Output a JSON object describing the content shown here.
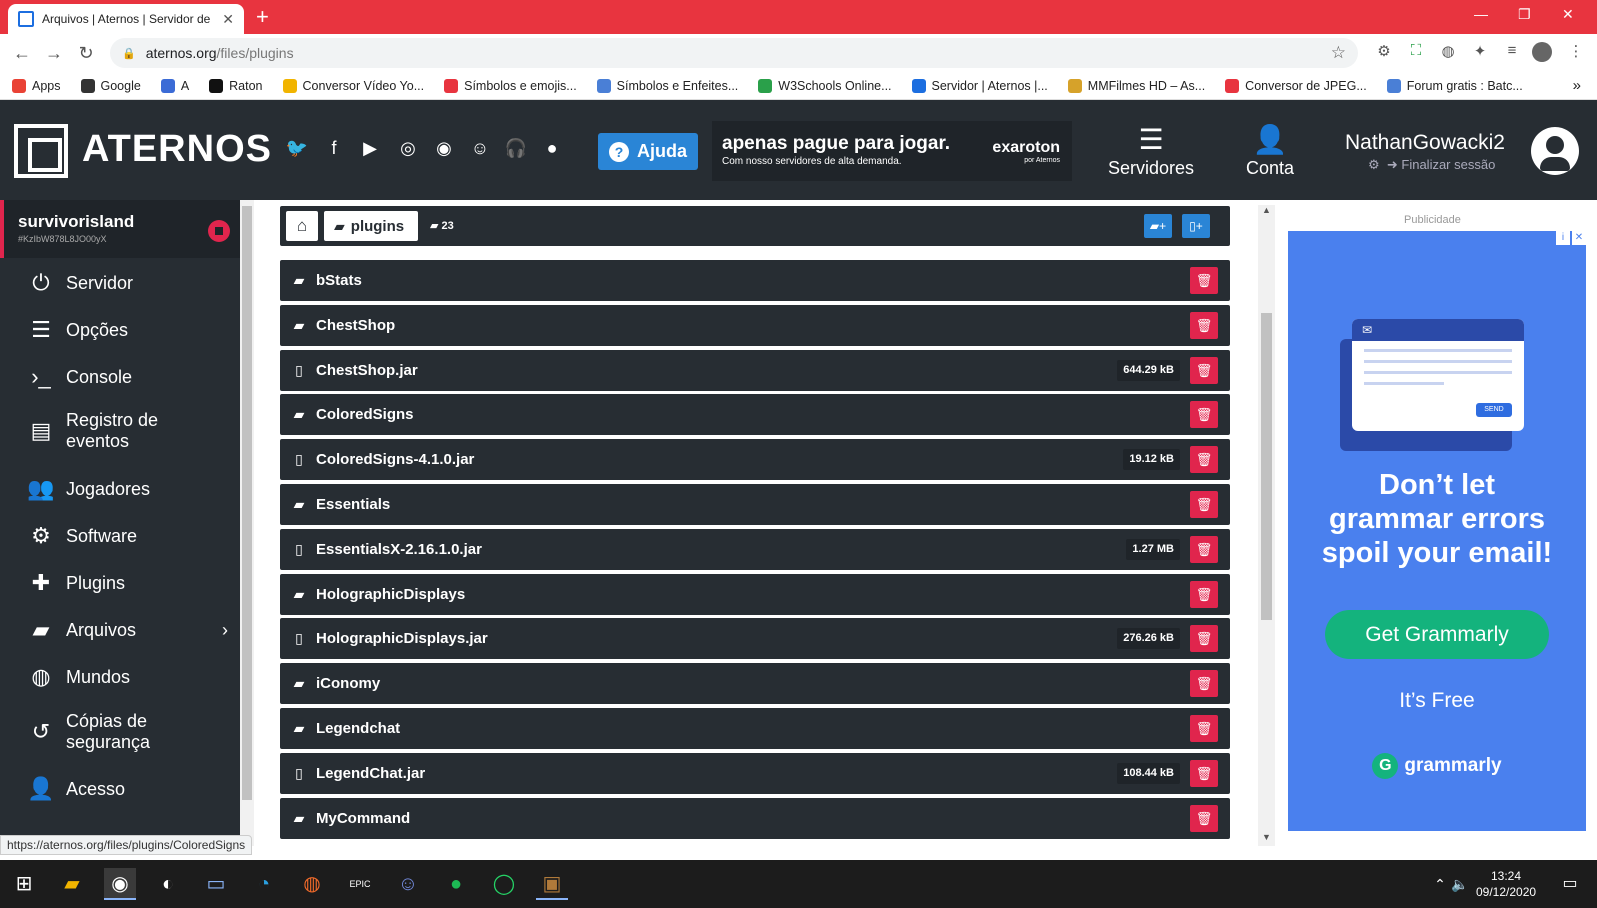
{
  "browser": {
    "tab_title": "Arquivos | Aternos | Servidor de M",
    "url_domain": "aternos.org",
    "url_path": "/files/plugins",
    "bookmarks": [
      {
        "label": "Apps",
        "color": "#e94235"
      },
      {
        "label": "Google",
        "color": "#333333"
      },
      {
        "label": "A",
        "color": "#3b6bd6"
      },
      {
        "label": "Raton",
        "color": "#111111"
      },
      {
        "label": "Conversor Vídeo Yo...",
        "color": "#f1b400"
      },
      {
        "label": "Símbolos e emojis...",
        "color": "#e8343f"
      },
      {
        "label": "Símbolos e Enfeites...",
        "color": "#4a7fd6"
      },
      {
        "label": "W3Schools Online...",
        "color": "#2aa04a"
      },
      {
        "label": "Servidor | Aternos |...",
        "color": "#1c6ee0"
      },
      {
        "label": "MMFilmes HD – As...",
        "color": "#d6a22a"
      },
      {
        "label": "Conversor de JPEG...",
        "color": "#e8343f"
      },
      {
        "label": "Forum gratis : Batc...",
        "color": "#4a7fd6"
      }
    ],
    "status_url": "https://aternos.org/files/plugins/ColoredSigns"
  },
  "header": {
    "brand": "ATERNOS",
    "help_label": "Ajuda",
    "promo_title": "apenas pague para jogar.",
    "promo_sub": "Com nosso servidores de alta demanda.",
    "promo_brand": "exaroton",
    "promo_brand_sub": "por Aternos",
    "nav_servers": "Servidores",
    "nav_account": "Conta",
    "username": "NathanGowacki2",
    "logout": "Finalizar sessão"
  },
  "sidebar": {
    "server_name": "survivorisland",
    "server_id": "#KzIbW878L8JO00yX",
    "items": [
      {
        "label": "Servidor",
        "icon": "⏻"
      },
      {
        "label": "Opções",
        "icon": "☰"
      },
      {
        "label": "Console",
        "icon": "›_"
      },
      {
        "label": "Registro de",
        "label2": "eventos",
        "icon": "▤"
      },
      {
        "label": "Jogadores",
        "icon": "👥"
      },
      {
        "label": "Software",
        "icon": "⚙"
      },
      {
        "label": "Plugins",
        "icon": "✚"
      },
      {
        "label": "Arquivos",
        "icon": "▰"
      },
      {
        "label": "Mundos",
        "icon": "◍"
      },
      {
        "label": "Cópias de",
        "label2": "segurança",
        "icon": "↺"
      },
      {
        "label": "Acesso",
        "icon": "👤"
      }
    ]
  },
  "files": {
    "current_dir": "plugins",
    "count": "23",
    "rows": [
      {
        "name": "bStats",
        "type": "folder",
        "size": ""
      },
      {
        "name": "ChestShop",
        "type": "folder",
        "size": ""
      },
      {
        "name": "ChestShop.jar",
        "type": "file",
        "size": "644.29 kB"
      },
      {
        "name": "ColoredSigns",
        "type": "folder",
        "size": ""
      },
      {
        "name": "ColoredSigns-4.1.0.jar",
        "type": "file",
        "size": "19.12 kB"
      },
      {
        "name": "Essentials",
        "type": "folder",
        "size": ""
      },
      {
        "name": "EssentialsX-2.16.1.0.jar",
        "type": "file",
        "size": "1.27 MB"
      },
      {
        "name": "HolographicDisplays",
        "type": "folder",
        "size": ""
      },
      {
        "name": "HolographicDisplays.jar",
        "type": "file",
        "size": "276.26 kB"
      },
      {
        "name": "iConomy",
        "type": "folder",
        "size": ""
      },
      {
        "name": "Legendchat",
        "type": "folder",
        "size": ""
      },
      {
        "name": "LegendChat.jar",
        "type": "file",
        "size": "108.44 kB"
      },
      {
        "name": "MyCommand",
        "type": "folder",
        "size": ""
      }
    ]
  },
  "ad": {
    "label": "Publicidade",
    "headline_1": "Don’t let",
    "headline_2": "grammar errors",
    "headline_3": "spoil your email!",
    "send": "SEND",
    "cta": "Get Grammarly",
    "free": "It’s Free",
    "brand": "grammarly"
  },
  "taskbar": {
    "time": "13:24",
    "date": "09/12/2020"
  }
}
